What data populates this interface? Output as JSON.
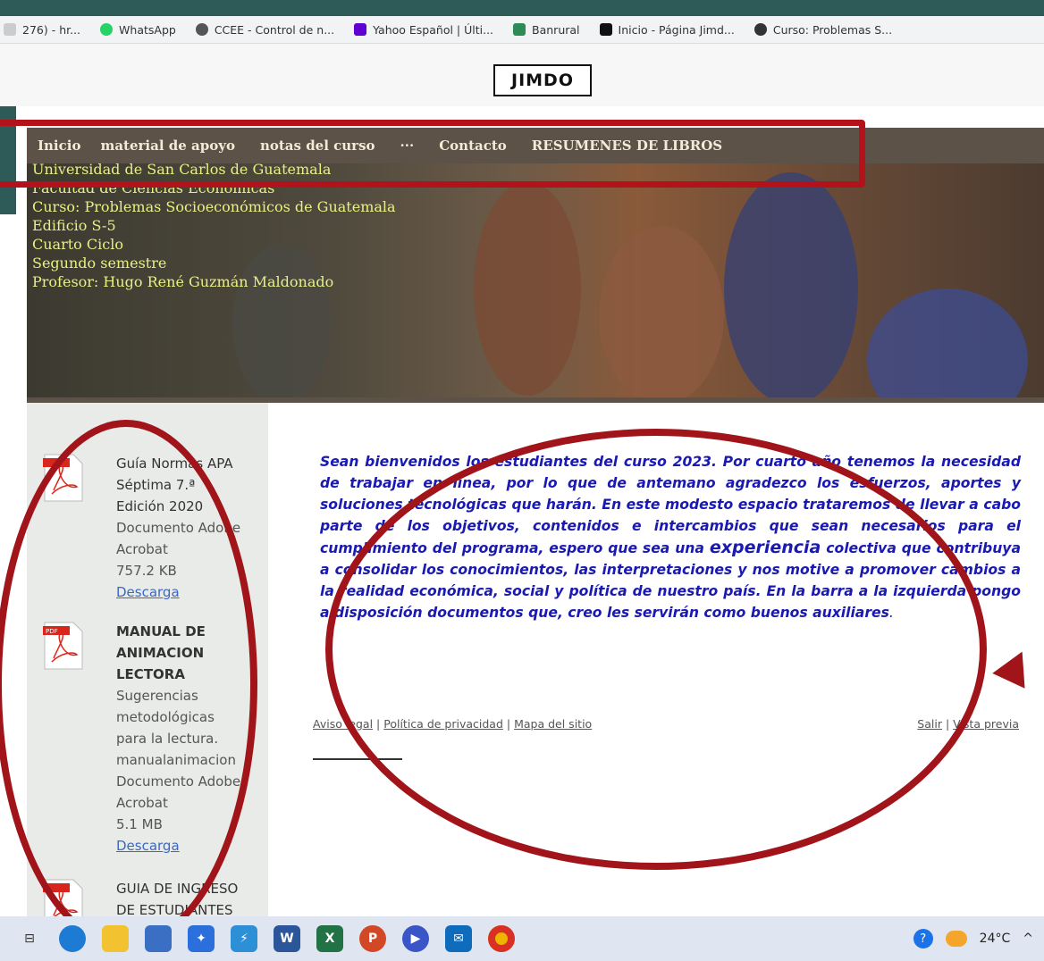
{
  "bookmarks": [
    {
      "label": "276) - hr...",
      "color": "#cccccc"
    },
    {
      "label": "WhatsApp",
      "color": "#25d366"
    },
    {
      "label": "CCEE - Control de n...",
      "color": "#555555"
    },
    {
      "label": "Yahoo Español | Últi...",
      "color": "#6001d2"
    },
    {
      "label": "Banrural",
      "color": "#2e8b57"
    },
    {
      "label": "Inicio - Página Jimd...",
      "color": "#111111"
    },
    {
      "label": "Curso: Problemas S...",
      "color": "#333333"
    }
  ],
  "jimdo_logo": "JIMDO",
  "nav": {
    "items": [
      "Inicio",
      "material de apoyo",
      "notas del curso",
      "···",
      "Contacto",
      "RESUMENES DE LIBROS"
    ]
  },
  "hero": {
    "lines": [
      "Universidad de San Carlos de Guatemala",
      "Facultad de Ciencias Económicas",
      "Curso: Problemas Socioeconómicos de Guatemala",
      "Edificio S-5",
      "Cuarto Ciclo",
      "Segundo semestre",
      "Profesor: Hugo René Guzmán Maldonado"
    ]
  },
  "sidebar": {
    "docs": [
      {
        "icon": "pdf-icon",
        "title": "Guía Normas APA Séptima 7.ª Edición 2020",
        "type": "Documento Adobe Acrobat",
        "size": "757.2 KB",
        "link": "Descarga"
      },
      {
        "icon": "pdf-icon",
        "title": "MANUAL DE ANIMACION LECTORA",
        "desc": "Sugerencias metodológicas para la lectura.",
        "filename": "manualanimacion",
        "type": "Documento Adobe Acrobat",
        "size": "5.1 MB",
        "link": "Descarga"
      },
      {
        "icon": "pdf-icon",
        "title": "GUIA DE INGRESO DE ESTUDIANTES A"
      }
    ]
  },
  "main": {
    "welcome_before": "Sean bienvenidos los estudiantes del curso 2023. Por cuarto año tenemos la necesidad de trabajar en línea, por lo que de antemano agradezco los esfuerzos, aportes y soluciones tecnológicas que harán. En este modesto espacio trataremos de llevar a cabo parte de los objetivos, contenidos e intercambios que sean necesarios para el cumplimiento del programa, espero que sea una ",
    "welcome_big": "experiencia",
    "welcome_after": " colectiva que contribuya a consolidar los conocimientos, las interpretaciones y nos motive a promover cambios a la realidad económica, social y política de nuestro país. En la barra a la izquierda pongo a disposición documentos que, creo les servirán como buenos auxiliares",
    "welcome_end": "."
  },
  "footer": {
    "aviso": "Aviso legal",
    "privacidad": "Política de privacidad",
    "mapa": "Mapa del sitio",
    "salir": "Salir",
    "vista": "Vista previa",
    "sep": "|"
  },
  "taskbar": {
    "temperature": "24°C",
    "icons": [
      "task-view-icon",
      "edge-icon",
      "file-explorer-icon",
      "store-icon",
      "dropbox-icon",
      "app-icon",
      "word-icon",
      "excel-icon",
      "powerpoint-icon",
      "media-icon",
      "mail-icon",
      "chrome-icon"
    ]
  },
  "colors": {
    "nav_bg": "#5d5247",
    "annotation_red": "#a0141a",
    "welcome_blue": "#1a1ab3",
    "hero_text": "#e8f083"
  }
}
